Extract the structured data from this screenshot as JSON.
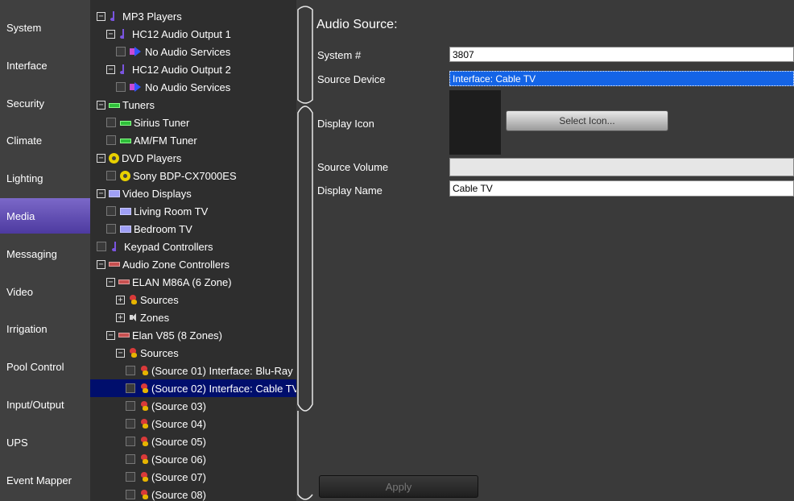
{
  "sidebar": {
    "items": [
      {
        "label": "System",
        "active": false
      },
      {
        "label": "Interface",
        "active": false
      },
      {
        "label": "Security",
        "active": false
      },
      {
        "label": "Climate",
        "active": false
      },
      {
        "label": "Lighting",
        "active": false
      },
      {
        "label": "Media",
        "active": true
      },
      {
        "label": "Messaging",
        "active": false
      },
      {
        "label": "Video",
        "active": false
      },
      {
        "label": "Irrigation",
        "active": false
      },
      {
        "label": "Pool Control",
        "active": false
      },
      {
        "label": "Input/Output",
        "active": false
      },
      {
        "label": "UPS",
        "active": false
      },
      {
        "label": "Event Mapper",
        "active": false
      }
    ]
  },
  "tree": {
    "nodes": [
      {
        "label": "MP3 Players",
        "level": 0,
        "expander": "minus",
        "icon": "note-icon"
      },
      {
        "label": "HC12 Audio Output 1",
        "level": 1,
        "expander": "minus",
        "icon": "note-icon"
      },
      {
        "label": "No Audio Services",
        "level": 2,
        "checkbox": true,
        "icon": "arrow-icon"
      },
      {
        "label": "HC12 Audio Output 2",
        "level": 1,
        "expander": "minus",
        "icon": "note-icon"
      },
      {
        "label": "No Audio Services",
        "level": 2,
        "checkbox": true,
        "icon": "arrow-icon"
      },
      {
        "label": "Tuners",
        "level": 0,
        "expander": "minus",
        "icon": "tuner-icon"
      },
      {
        "label": "Sirius Tuner",
        "level": 1,
        "checkbox": true,
        "icon": "tuner-icon"
      },
      {
        "label": "AM/FM Tuner",
        "level": 1,
        "checkbox": true,
        "icon": "tuner-icon"
      },
      {
        "label": "DVD Players",
        "level": 0,
        "expander": "minus",
        "icon": "dvd-icon"
      },
      {
        "label": "Sony BDP-CX7000ES",
        "level": 1,
        "checkbox": true,
        "icon": "dvd-icon"
      },
      {
        "label": "Video Displays",
        "level": 0,
        "expander": "minus",
        "icon": "display-icon"
      },
      {
        "label": "Living Room TV",
        "level": 1,
        "checkbox": true,
        "icon": "display-icon"
      },
      {
        "label": "Bedroom TV",
        "level": 1,
        "checkbox": true,
        "icon": "display-icon"
      },
      {
        "label": "Keypad Controllers",
        "level": 0,
        "checkbox": true,
        "icon": "note-icon"
      },
      {
        "label": "Audio Zone Controllers",
        "level": 0,
        "expander": "minus",
        "icon": "zone-controller-icon"
      },
      {
        "label": "ELAN M86A (6 Zone)",
        "level": 1,
        "expander": "minus",
        "icon": "zone-controller-icon"
      },
      {
        "label": "Sources",
        "level": 2,
        "expander": "plus",
        "icon": "source-icon"
      },
      {
        "label": "Zones",
        "level": 2,
        "expander": "plus",
        "icon": "speaker-icon"
      },
      {
        "label": "Elan V85 (8 Zones)",
        "level": 1,
        "expander": "minus",
        "icon": "zone-controller-icon"
      },
      {
        "label": "Sources",
        "level": 2,
        "expander": "minus",
        "icon": "source-icon"
      },
      {
        "label": "(Source 01) Interface: Blu-Ray",
        "level": 3,
        "checkbox": true,
        "icon": "source-icon"
      },
      {
        "label": "(Source 02) Interface: Cable TV",
        "level": 3,
        "checkbox": true,
        "icon": "source-icon",
        "selected": true
      },
      {
        "label": "(Source 03)",
        "level": 3,
        "checkbox": true,
        "icon": "source-icon"
      },
      {
        "label": "(Source 04)",
        "level": 3,
        "checkbox": true,
        "icon": "source-icon"
      },
      {
        "label": "(Source 05)",
        "level": 3,
        "checkbox": true,
        "icon": "source-icon"
      },
      {
        "label": "(Source 06)",
        "level": 3,
        "checkbox": true,
        "icon": "source-icon"
      },
      {
        "label": "(Source 07)",
        "level": 3,
        "checkbox": true,
        "icon": "source-icon"
      },
      {
        "label": "(Source 08)",
        "level": 3,
        "checkbox": true,
        "icon": "source-icon"
      }
    ]
  },
  "form": {
    "title": "Audio Source:",
    "system_number": {
      "label": "System #",
      "value": "3807"
    },
    "source_device": {
      "label": "Source Device",
      "value": "Interface: Cable TV"
    },
    "display_icon": {
      "label": "Display Icon",
      "button_label": "Select Icon..."
    },
    "source_volume": {
      "label": "Source Volume",
      "value": ""
    },
    "display_name": {
      "label": "Display Name",
      "value": "Cable TV"
    },
    "apply_label": "Apply"
  },
  "colors": {
    "active_nav": "#5a47b0",
    "selected_row": "#000e6c",
    "source_device_highlight": "#1464e6"
  }
}
